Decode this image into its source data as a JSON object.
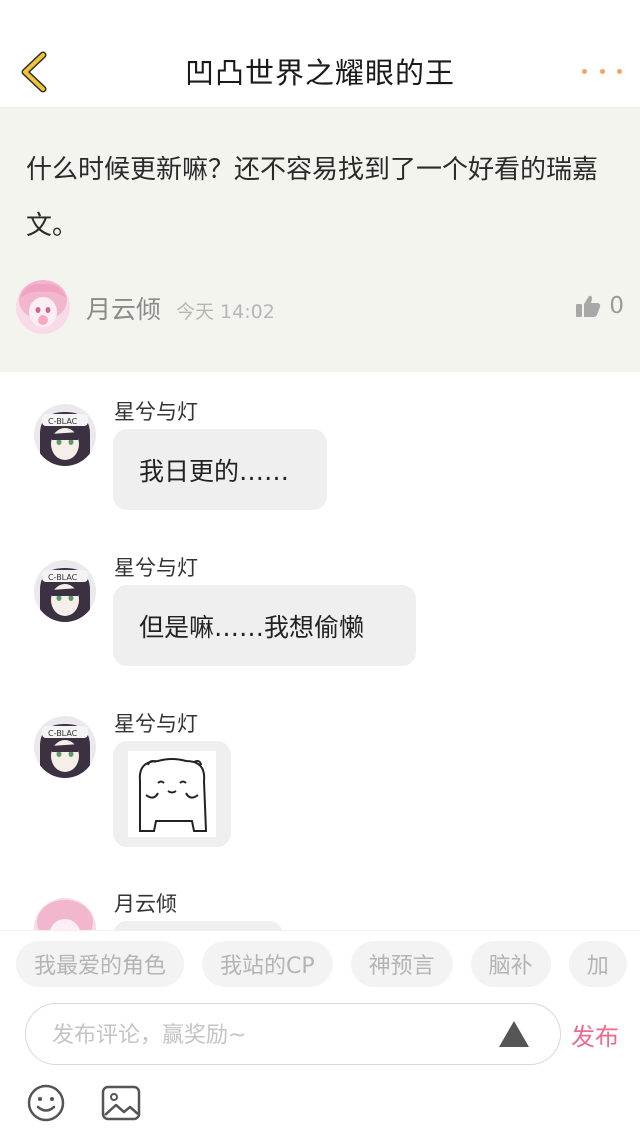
{
  "header": {
    "title": "凹凸世界之耀眼的王"
  },
  "colors": {
    "accent_back": "#f0c23a",
    "more_dots": "#f2a65a",
    "publish": "#ee6a8e",
    "post_bg": "#f4f4ef",
    "bubble_bg": "#efefef"
  },
  "post": {
    "text": "什么时候更新嘛？还不容易找到了一个好看的瑞嘉文。",
    "author": "月云倾",
    "time": "今天 14:02",
    "likes": "0"
  },
  "messages": [
    {
      "name": "星兮与灯",
      "text": "我日更的……"
    },
    {
      "name": "星兮与灯",
      "text": "但是嘛……我想偷懒"
    },
    {
      "name": "星兮与灯",
      "sticker": "bear-sticker"
    },
    {
      "name": "月云倾"
    }
  ],
  "chips": [
    "我最爱的角色",
    "我站的CP",
    "神预言",
    "脑补",
    "加"
  ],
  "composer": {
    "placeholder": "发布评论，赢奖励~",
    "publish_label": "发布"
  },
  "icons": {
    "back": "chevron-left-icon",
    "more": "more-dots-icon",
    "like": "thumbs-up-icon",
    "send": "triangle-send-icon",
    "emoji": "emoji-face-icon",
    "image": "image-icon"
  }
}
